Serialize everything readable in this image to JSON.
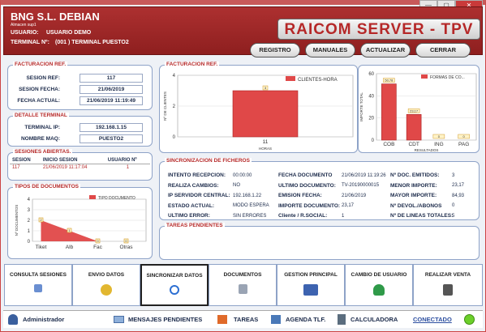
{
  "window": {
    "min": "—",
    "max": "▢",
    "close": "✕"
  },
  "header": {
    "company": "BNG S.L. DEBIAN",
    "store": "Almacen sup1",
    "user_label": "USUARIO:",
    "user_value": "USUARIO DEMO",
    "terminal_label": "TERMINAL Nº:",
    "terminal_value": "(001 )  TERMINAL PUESTO2",
    "app_title": "RAICOM SERVER - TPV",
    "buttons": [
      "REGISTRO",
      "MANUALES",
      "ACTUALIZAR",
      "CERRAR"
    ]
  },
  "facturacion": {
    "title": "FACTURACION REF.",
    "sesion_ref_label": "SESION REF:",
    "sesion_ref": "117",
    "sesion_fecha_label": "SESION FECHA:",
    "sesion_fecha": "21/06/2019",
    "fecha_actual_label": "FECHA ACTUAL:",
    "fecha_actual": "21/06/2019 11:19:49"
  },
  "terminal": {
    "title": "DETALLE TERMINAL",
    "ip_label": "TERMINAL IP:",
    "ip": "192.168.1.15",
    "maq_label": "NOMBRE MAQ:",
    "maq": "PUESTO2"
  },
  "sesiones": {
    "title": "SESIONES ABIERTAS.",
    "headers": [
      "SESION",
      "INICIO SESION",
      "USUARIO Nº"
    ],
    "rows": [
      [
        "117",
        "21/06/2019 11:17:04",
        "1"
      ]
    ]
  },
  "tipos": {
    "title": "TIPOS DE DOCUMENTOS",
    "legend": "TIPO DOCUMENTO",
    "ylabel": "Nº DOCUMENTOS",
    "categories": [
      "Tiket",
      "Alb",
      "Fac",
      "Otras"
    ],
    "values": [
      2,
      1,
      0,
      0
    ],
    "yticks": [
      "0",
      "1",
      "2",
      "3",
      "4"
    ],
    "point_labels": [
      "2",
      "1",
      "0",
      "0"
    ]
  },
  "fact_chart": {
    "title": "FACTURACION REF.",
    "legend": "CLIENTES-HORA",
    "ylabel": "Nº DE CLIENTES",
    "xlabel": "HORAS",
    "categories": [
      "11"
    ],
    "values": [
      3
    ],
    "yticks": [
      "0",
      "2",
      "4"
    ],
    "point_labels": [
      "3"
    ]
  },
  "formas_chart": {
    "legend": "FORMAS DE CO...",
    "ylabel": "IMPORTE TOTAL",
    "xlabel": "RESULTADOS",
    "categories": [
      "COB",
      "CDT",
      "ING",
      "PAG"
    ],
    "values": [
      50.78,
      23.17,
      0,
      0
    ],
    "yticks": [
      "0",
      "20",
      "40",
      "60"
    ],
    "point_labels": [
      "50,78",
      "23,17",
      "0",
      "0"
    ]
  },
  "sync": {
    "title": "SINCRONIZACION DE FICHEROS",
    "col1": [
      [
        "INTENTO RECEPCION:",
        "00:00:00"
      ],
      [
        "REALIZA CAMBIOS:",
        "NO"
      ],
      [
        "IP SERVIDOR CENTRAL:",
        "192.168.1.22"
      ],
      [
        "ESTADO ACTUAL:",
        "MODO ESPERA"
      ],
      [
        "ULTIMO ERROR:",
        "SIN ERRORES"
      ]
    ],
    "col2": [
      [
        "FECHA DOCUMENTO",
        "21/06/2019 11:19:26"
      ],
      [
        "ULTIMO DOCUMENTO:",
        "TV-20190000015"
      ],
      [
        "EMISION FECHA:",
        "21/06/2019"
      ],
      [
        "IMPORTE DOCUMENTO:",
        "23,17"
      ],
      [
        "Cliente / R.SOCIAL:",
        "1"
      ]
    ],
    "col3": [
      [
        "Nº DOC. EMITIDOS:",
        "3"
      ],
      [
        "MENOR IMPORTE:",
        "23,17"
      ],
      [
        "MAYOR IMPORTE:",
        "84,93"
      ],
      [
        "Nº DEVOL./ABONOS",
        "0"
      ],
      [
        "Nº DE LINEAS TOTALES:",
        "5"
      ]
    ]
  },
  "tareas": {
    "title": "TAREAS PENDIENTES"
  },
  "bottom_buttons": [
    "CONSULTA SESIONES",
    "ENVIO DATOS",
    "SINCRONIZAR DATOS",
    "DOCUMENTOS",
    "GESTION PRINCIPAL",
    "CAMBIO DE USUARIO",
    "REALIZAR VENTA"
  ],
  "statusbar": {
    "user": "Administrador",
    "mensajes": "MENSAJES PENDIENTES",
    "tareas": "TAREAS",
    "agenda": "AGENDA TLF.",
    "calculadora": "CALCULADORA",
    "conectado": "CONECTADO"
  },
  "colors": {
    "accent": "#b52828",
    "bar": "#e04848",
    "panel_border": "#8ea3c8",
    "status_ok": "#6ccf2a"
  }
}
